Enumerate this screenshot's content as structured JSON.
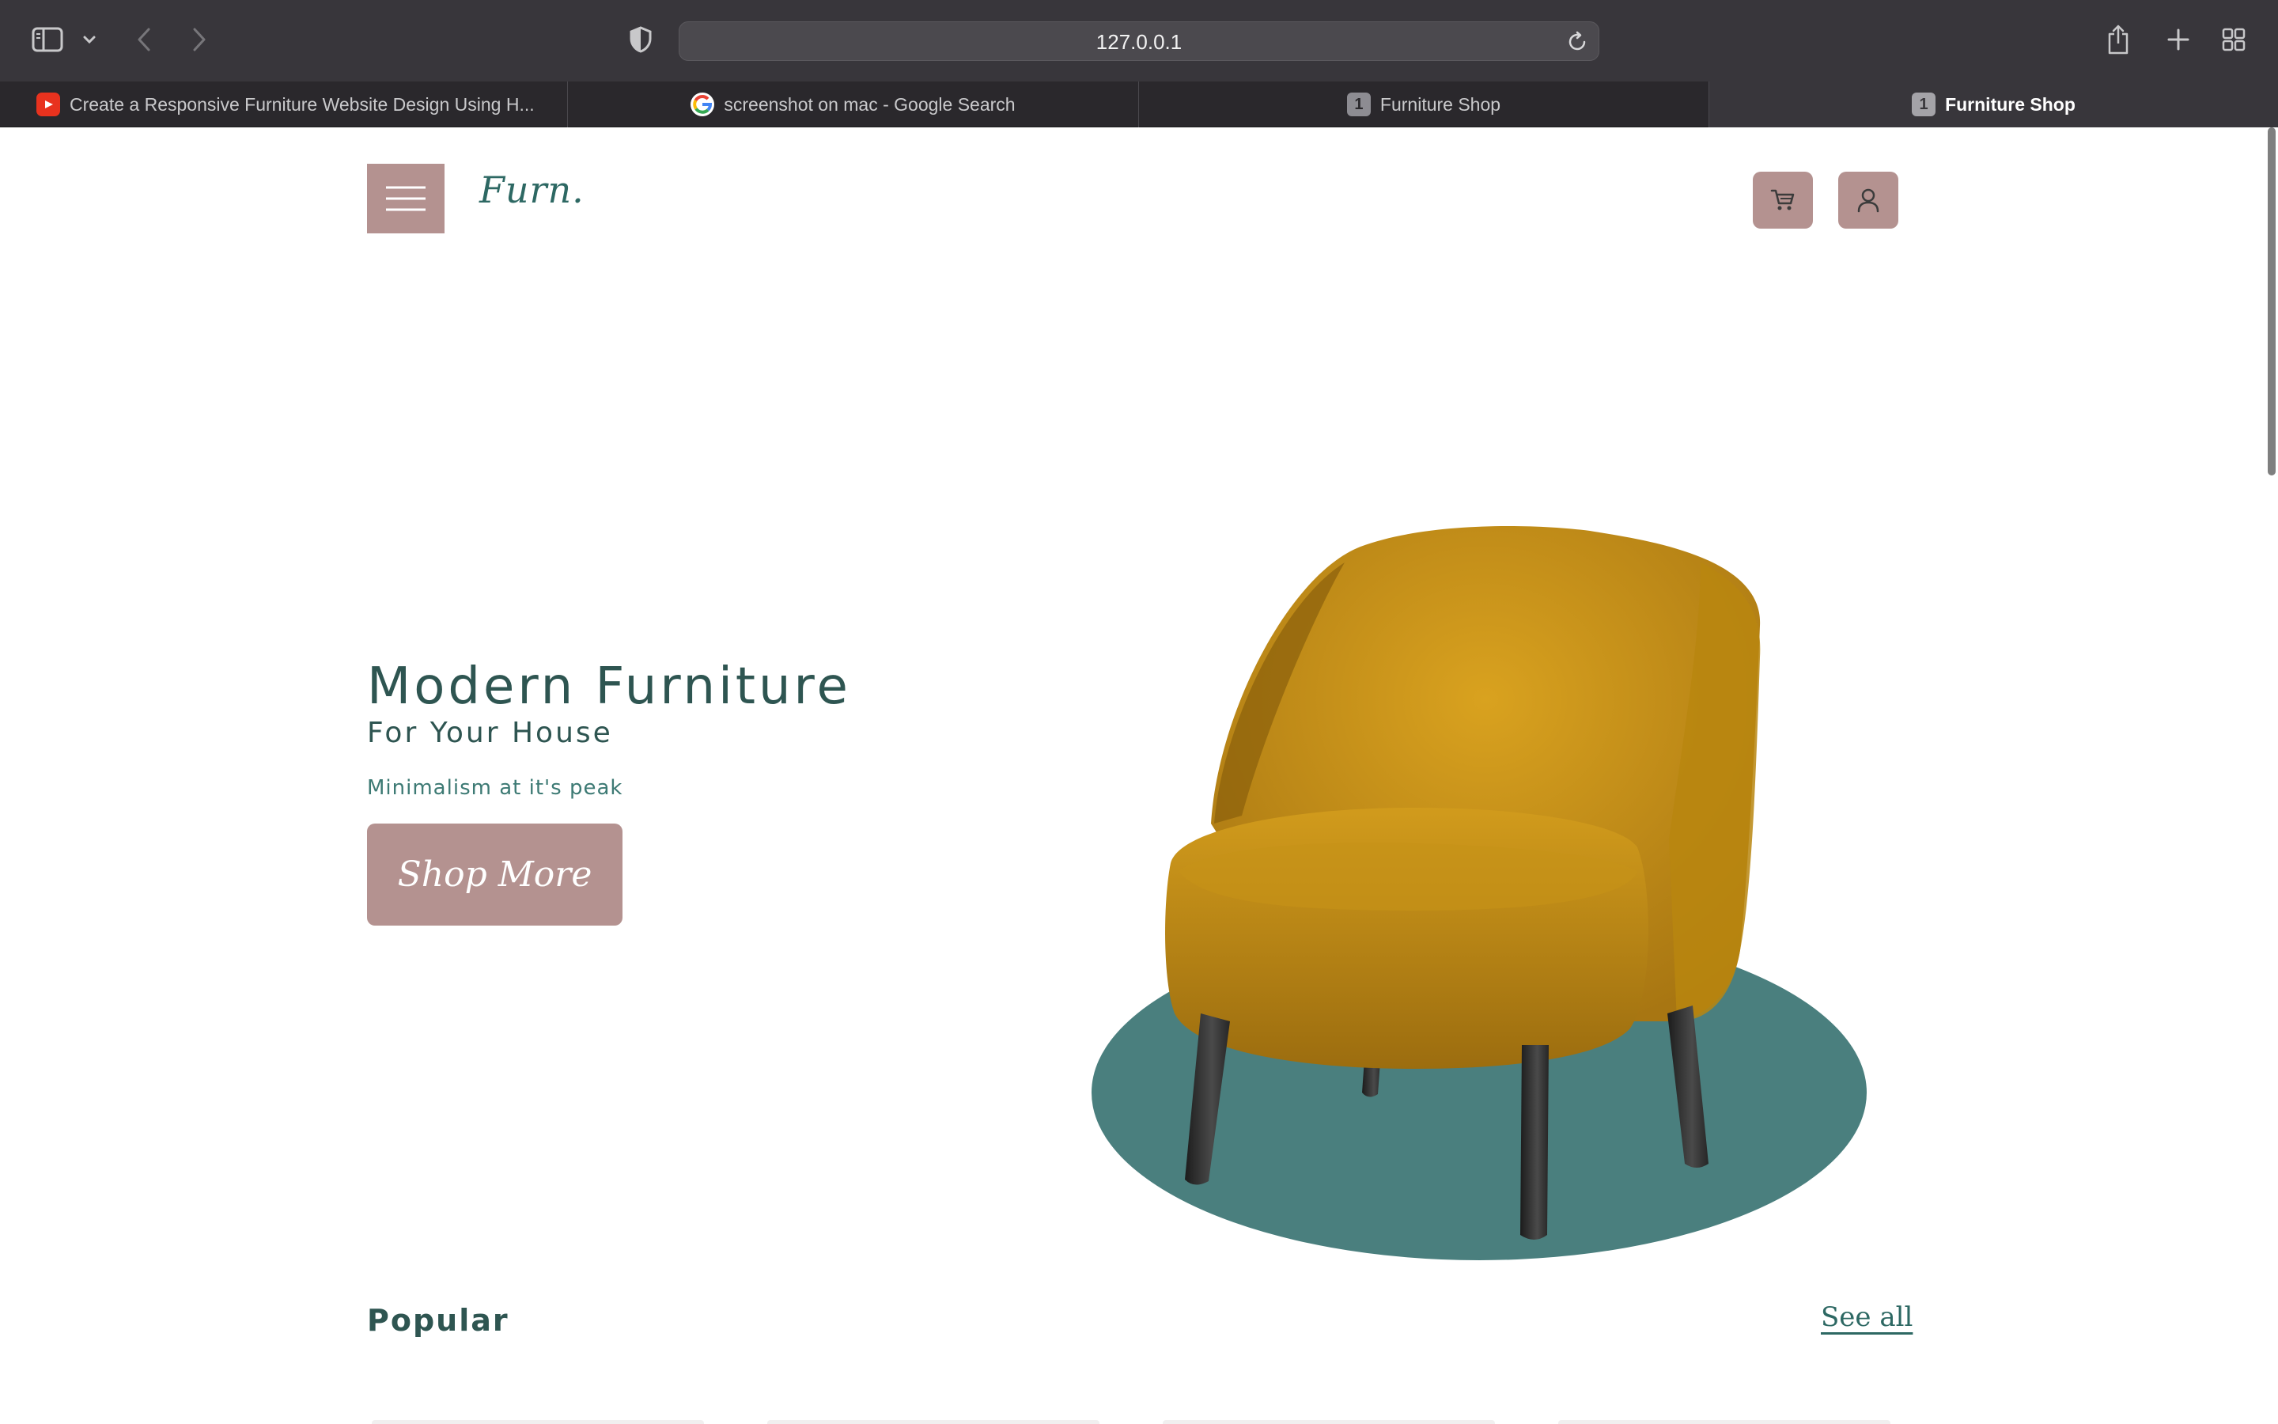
{
  "browser": {
    "address": "127.0.0.1",
    "tabs": [
      {
        "label": "Create a Responsive Furniture Website Design Using H...",
        "favicon": "youtube-icon",
        "active": false
      },
      {
        "label": "screenshot on mac - Google Search",
        "favicon": "google-icon",
        "active": false
      },
      {
        "label": "Furniture Shop",
        "favicon": "1",
        "active": false
      },
      {
        "label": "Furniture Shop",
        "favicon": "1",
        "active": true
      }
    ]
  },
  "site": {
    "logo": "Furn.",
    "hero": {
      "title": "Modern Furniture",
      "subtitle": "For Your House",
      "tagline": "Minimalism at it's peak",
      "button": "Shop More"
    },
    "popular": {
      "title": "Popular",
      "see_all": "See all"
    }
  },
  "colors": {
    "accent": "#b49290",
    "brand_teal": "#2d6863",
    "text_dark": "#2e5551",
    "chair_yellow": "#c8951a",
    "backdrop_teal": "#4a7f7e"
  }
}
